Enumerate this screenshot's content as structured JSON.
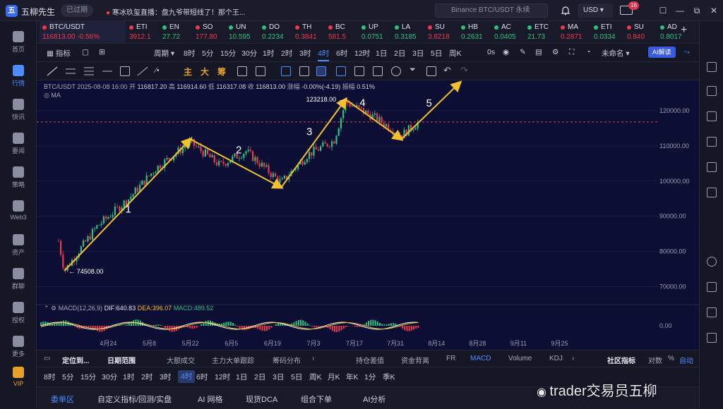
{
  "app": {
    "name": "五柳先生",
    "expired": "已过期",
    "news": "寒冰玖玺直播：盘九爷带短线了！那个王..."
  },
  "search": {
    "placeholder": "Binance BTC/USDT 永续"
  },
  "currency": "USD",
  "mail_badge": "16",
  "window_controls": [
    "☐",
    "—",
    "⧉",
    "✕"
  ],
  "leftnav": [
    {
      "label": "首页",
      "icon": "home-icon"
    },
    {
      "label": "行情",
      "icon": "market-icon"
    },
    {
      "label": "快讯",
      "icon": "flash-news-icon"
    },
    {
      "label": "要闻",
      "icon": "news-icon"
    },
    {
      "label": "策略",
      "icon": "strategy-icon"
    },
    {
      "label": "Web3",
      "icon": "web3-icon"
    },
    {
      "label": "资产",
      "icon": "assets-icon"
    },
    {
      "label": "群聊",
      "icon": "chat-icon"
    },
    {
      "label": "授权",
      "icon": "auth-icon"
    },
    {
      "label": "更多",
      "icon": "more-icon"
    },
    {
      "label": "VIP",
      "icon": "vip-icon"
    }
  ],
  "tabs": [
    {
      "name": "BTC/USDT",
      "price": "116813.00",
      "change": "-0.56%",
      "dir": "dn"
    },
    {
      "name": "ETI",
      "price": "3912.1",
      "dir": "dn"
    },
    {
      "name": "EN",
      "price": "27.72",
      "dir": "up"
    },
    {
      "name": "SO",
      "price": "177.80",
      "dir": "dn"
    },
    {
      "name": "UN",
      "price": "10.595",
      "dir": "up"
    },
    {
      "name": "DO",
      "price": "0.2234",
      "dir": "up"
    },
    {
      "name": "TH",
      "price": "0.3841",
      "dir": "dn"
    },
    {
      "name": "BC",
      "price": "581.5",
      "dir": "dn"
    },
    {
      "name": "UP",
      "price": "0.0751",
      "dir": "up"
    },
    {
      "name": "LA",
      "price": "0.3185",
      "dir": "up"
    },
    {
      "name": "SU",
      "price": "3.8218",
      "dir": "dn"
    },
    {
      "name": "HB",
      "price": "0.2631",
      "dir": "up"
    },
    {
      "name": "AC",
      "price": "0.0405",
      "dir": "up"
    },
    {
      "name": "ETC",
      "price": "21.73",
      "dir": "up"
    },
    {
      "name": "MA",
      "price": "0.2871",
      "dir": "dn"
    },
    {
      "name": "ETI",
      "price": "0.0334",
      "dir": "up"
    },
    {
      "name": "SU",
      "price": "0.840",
      "dir": "dn"
    },
    {
      "name": "AD",
      "price": "0.8017",
      "dir": "up"
    }
  ],
  "toolbar": {
    "indicators": "指标",
    "period": "周期",
    "intervals": [
      "8时",
      "5分",
      "15分",
      "30分",
      "1时",
      "2时",
      "3时",
      "4时",
      "6时",
      "12时",
      "1日",
      "2日",
      "3日",
      "5日",
      "周K"
    ],
    "selected_interval": "4时",
    "seconds": "0s",
    "unnamed": "未命名",
    "ai_label": "AI解读"
  },
  "drawtools": {
    "counts": [
      "主",
      "大",
      "筹"
    ]
  },
  "legend": {
    "symbol": "BTC/USDT",
    "datetime": "2025-08-08 16:00",
    "open_label": "开",
    "open": "116817.20",
    "high_label": "高",
    "high": "116914.60",
    "low_label": "低",
    "low": "116317.08",
    "close_label": "收",
    "close": "116813.00",
    "change_label": "涨幅",
    "change": "-0.00%(-4.19)",
    "amp_label": "振幅",
    "amp": "0.51%",
    "ma": "MA"
  },
  "macd_legend": {
    "name": "MACD(12,26,9)",
    "dif": "DIF:640.83",
    "dea": "DEA:396.07",
    "macd": "MACD:489.52"
  },
  "chart_data": {
    "type": "candlestick-line",
    "x_tick_labels": [
      "4月24",
      "5月8",
      "5月22",
      "6月5",
      "6月19",
      "7月3",
      "7月17",
      "7月31",
      "8月14",
      "8月28",
      "9月11",
      "9月25"
    ],
    "y_tick_labels": [
      "120000.00",
      "110000.00",
      "100000.00",
      "90000.00",
      "80000.00",
      "70000.00"
    ],
    "y_values": [
      120000,
      110000,
      100000,
      90000,
      80000,
      70000
    ],
    "ylim": [
      65500,
      127000
    ],
    "macd_axis_label": "0.00",
    "dashed_level": 116813,
    "annotations": [
      {
        "label": "74508.00",
        "value": 74508
      },
      {
        "label": "123218.00",
        "value": 123218
      }
    ],
    "wave_labels": [
      "1",
      "2",
      "3",
      "4",
      "5"
    ],
    "wave_points": [
      {
        "date": "4月9",
        "price": 74508
      },
      {
        "date": "5月22",
        "price": 111900
      },
      {
        "date": "6月22",
        "price": 98200
      },
      {
        "date": "7月14",
        "price": 123218
      },
      {
        "date": "8月2",
        "price": 111900
      },
      {
        "date": "8月22",
        "price": 128000
      }
    ],
    "price_path": [
      {
        "date": "4月7",
        "price": 83000
      },
      {
        "date": "4月9",
        "price": 74508
      },
      {
        "date": "4月20",
        "price": 87000
      },
      {
        "date": "5月1",
        "price": 95000
      },
      {
        "date": "5月10",
        "price": 103500
      },
      {
        "date": "5月22",
        "price": 111000
      },
      {
        "date": "6月1",
        "price": 104500
      },
      {
        "date": "6月10",
        "price": 108500
      },
      {
        "date": "6月22",
        "price": 99500
      },
      {
        "date": "7月1",
        "price": 107500
      },
      {
        "date": "7月10",
        "price": 111500
      },
      {
        "date": "7月14",
        "price": 122500
      },
      {
        "date": "7月24",
        "price": 118000
      },
      {
        "date": "8月2",
        "price": 113000
      },
      {
        "date": "8月8",
        "price": 116813
      }
    ],
    "colors": {
      "up": "#2ec27e",
      "down": "#f0384d",
      "wave": "#f2c12e",
      "dashed": "#d14b4b"
    }
  },
  "rangebar": {
    "locate": "定位到...",
    "range": "日期范围",
    "items": [
      "大额成交",
      "主力大单跟踪",
      "筹码分布"
    ],
    "items2": [
      "持仓差值",
      "资金背离",
      "FR",
      "MACD",
      "Volume",
      "KDJ"
    ],
    "selected": "MACD",
    "community": "社区指标",
    "log": "对数",
    "pct": "%",
    "auto": "自动"
  },
  "periodbar": {
    "items": [
      "8时",
      "5分",
      "15分",
      "30分",
      "1时",
      "2时",
      "3时",
      "4时",
      "6时",
      "12时",
      "1日",
      "2日",
      "3日",
      "5日",
      "周K",
      "月K",
      "年K",
      "1分",
      "季K"
    ],
    "selected": "4时"
  },
  "bottomtabs": [
    "委单区",
    "自定义指标/回测/实盘",
    "AI 网格",
    "现货DCA",
    "组合下单",
    "AI分析"
  ],
  "watermark": "trader交易员五柳",
  "accent": "#4e8cff"
}
